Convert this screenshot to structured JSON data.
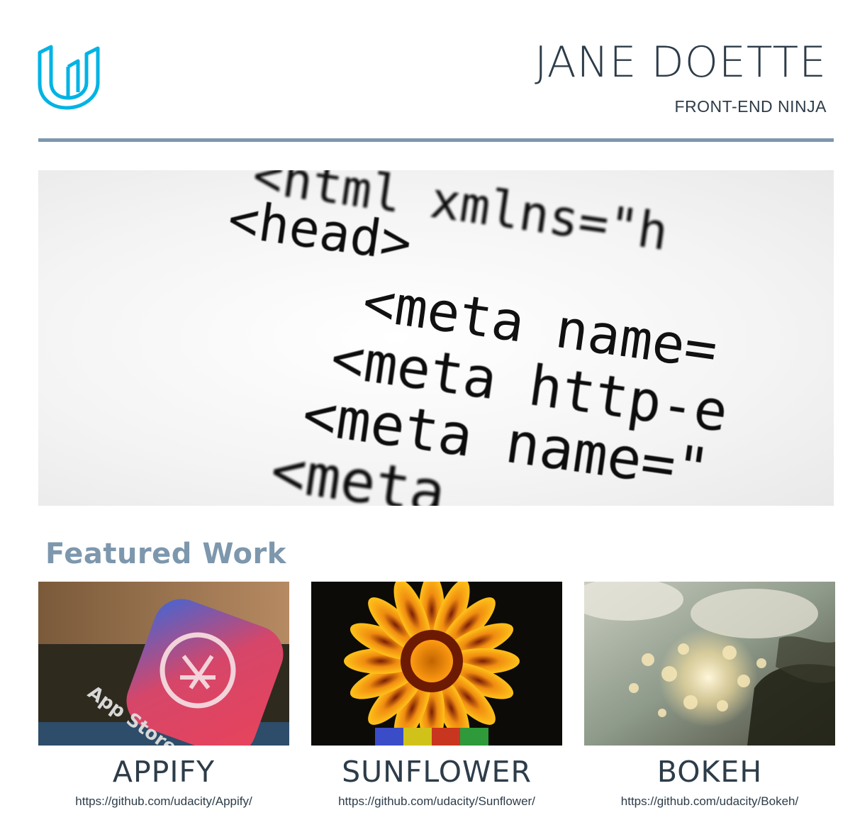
{
  "header": {
    "name": "JANE DOETTE",
    "tagline": "FRONT-END NINJA",
    "logo_icon": "udacity-logo-icon",
    "accent_color": "#02b3e4"
  },
  "hero": {
    "code_lines": [
      "<html  xmlns=\"h",
      "<head>",
      "<meta name=",
      "<meta http-e",
      "<meta name=\"",
      "<meta"
    ]
  },
  "featured": {
    "title": "Featured Work",
    "title_color": "#7d97ad",
    "items": [
      {
        "title": "APPIFY",
        "url": "https://github.com/udacity/Appify/",
        "image_text": "App Store"
      },
      {
        "title": "SUNFLOWER",
        "url": "https://github.com/udacity/Sunflower/"
      },
      {
        "title": "BOKEH",
        "url": "https://github.com/udacity/Bokeh/"
      }
    ]
  },
  "colors": {
    "text": "#2d3c49",
    "divider": "#7d97ad"
  }
}
